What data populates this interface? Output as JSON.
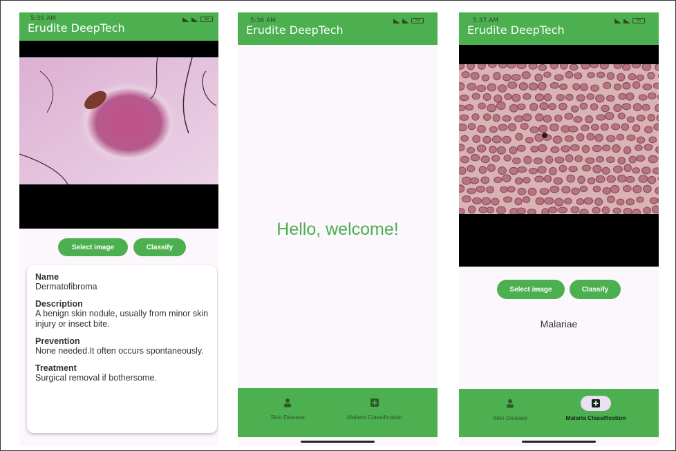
{
  "app_title": "Erudite DeepTech",
  "screens": {
    "skin": {
      "status_time": "5:36 AM",
      "battery": "55",
      "select_label": "Select image",
      "classify_label": "Classify",
      "result": {
        "name_label": "Name",
        "name": "Dermatofibroma",
        "description_label": "Description",
        "description": "A benign skin nodule, usually from minor skin injury or insect bite.",
        "prevention_label": "Prevention",
        "prevention": "None needed.It often occurs spontaneously.",
        "treatment_label": "Treatment",
        "treatment": "Surgical removal if bothersome."
      }
    },
    "home": {
      "status_time": "5:36 AM",
      "battery": "55",
      "welcome": "Hello, welcome!",
      "colors": {
        "welcome_text": "#4caf50"
      }
    },
    "malaria": {
      "status_time": "5:37 AM",
      "battery": "55",
      "select_label": "Select image",
      "classify_label": "Classify",
      "result": "Malariae"
    }
  },
  "bottom_nav": {
    "items": [
      {
        "label": "Skin Disease",
        "icon": "person-icon"
      },
      {
        "label": "Malaria Classification",
        "icon": "medical-plus-icon"
      }
    ]
  },
  "colors": {
    "accent": "#4caf50",
    "background": "#fcf7fc",
    "nav_active_pill": "#ecdff5"
  }
}
